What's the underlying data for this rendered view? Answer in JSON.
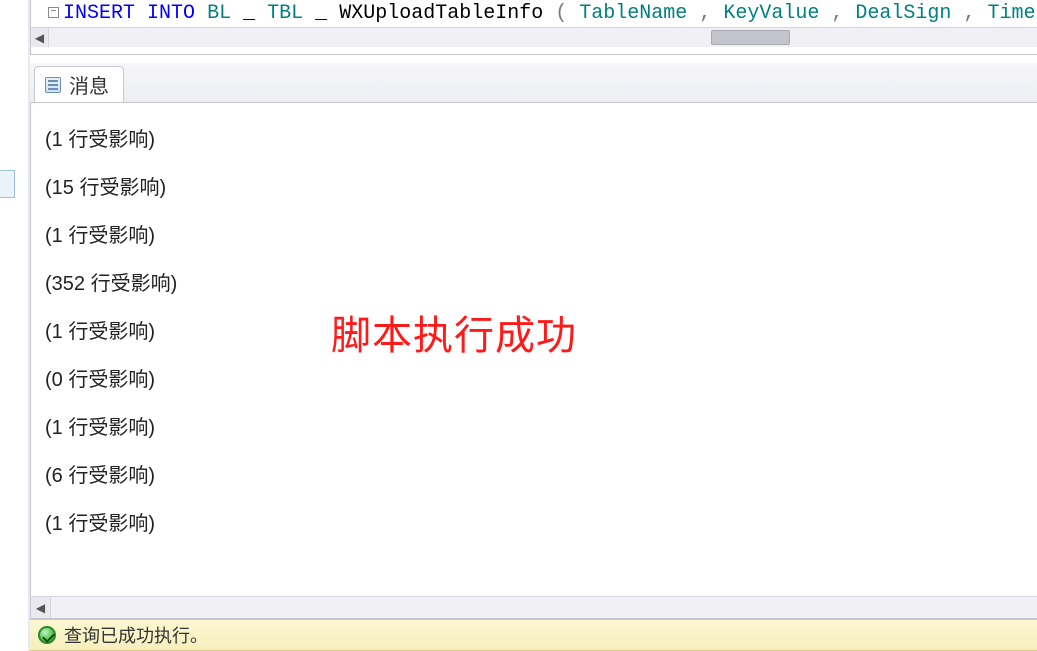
{
  "sql": {
    "fold_glyph": "−",
    "tokens": {
      "insert": "INSERT",
      "into": "INTO",
      "bl": "BL",
      "tbl": "TBL",
      "proc": "WXUploadTableInfo",
      "open": "(",
      "col1": "TableName",
      "comma1": ",",
      "col2": "KeyValue",
      "comma2": ",",
      "col3": "DealSign",
      "comma3": ",",
      "col4": "Time"
    }
  },
  "scroll": {
    "left_arrow": "◀",
    "right_arrow": "▶"
  },
  "tab": {
    "label": "消息"
  },
  "messages": {
    "rows_label": "行受影响",
    "items": [
      {
        "count": "1"
      },
      {
        "count": "15"
      },
      {
        "count": "1"
      },
      {
        "count": "352"
      },
      {
        "count": "1"
      },
      {
        "count": "0"
      },
      {
        "count": "1"
      },
      {
        "count": "6"
      },
      {
        "count": "1"
      }
    ]
  },
  "overlay": {
    "text": "脚本执行成功"
  },
  "status": {
    "text": "查询已成功执行。"
  }
}
